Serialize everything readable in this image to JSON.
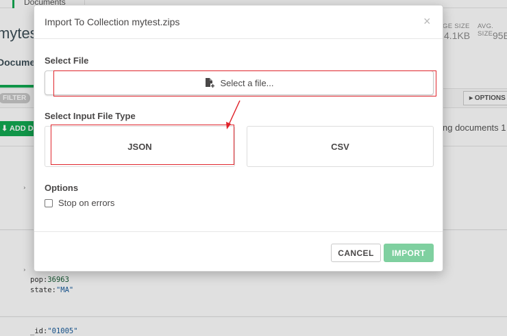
{
  "background": {
    "tab_label": "Documents",
    "collection_title": "mytest",
    "stats": [
      {
        "label": "GE SIZE",
        "value": "4.1KB"
      },
      {
        "label": "AVG. SIZE",
        "value": "95E"
      }
    ],
    "documents_tab": "Documen",
    "filter_label": "FILTER",
    "options_label": "OPTIONS",
    "add_label": "ADD D",
    "displaying_text": "ng documents 1",
    "doc1": {
      "caret": "›"
    },
    "doc2": {
      "pop_key": "pop:",
      "pop_val": "36963",
      "state_key": "state:",
      "state_val": "\"MA\"",
      "caret": "›"
    },
    "doc3": {
      "id_key": "_id:",
      "id_val": "\"01005\""
    }
  },
  "modal": {
    "title": "Import To Collection mytest.zips",
    "close": "×",
    "select_file_label": "Select File",
    "select_file_button": "Select a file...",
    "file_type_label": "Select Input File Type",
    "file_types": [
      "JSON",
      "CSV"
    ],
    "options_label": "Options",
    "stop_on_errors": "Stop on errors",
    "stop_on_errors_checked": false,
    "cancel": "CANCEL",
    "import": "IMPORT"
  },
  "colors": {
    "accent": "#13aa52",
    "import_disabled": "#7fd0a0",
    "annotation": "#e0242b"
  },
  "icons": {
    "file_button": "file-add-icon",
    "options_caret": "caret-right-icon",
    "add_button": "download-icon"
  }
}
